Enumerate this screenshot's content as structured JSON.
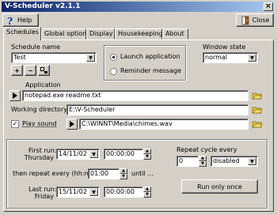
{
  "window": {
    "title": "V-Scheduler v2.1.1",
    "close_glyph": "×"
  },
  "toolbar": {
    "help_label": "Help",
    "close_label": "Close"
  },
  "tabs": [
    {
      "label": "Schedules"
    },
    {
      "label": "Global options"
    },
    {
      "label": "Display"
    },
    {
      "label": "Housekeeping"
    },
    {
      "label": "About"
    }
  ],
  "schedule": {
    "name_label": "Schedule name",
    "name_value": "Test",
    "add_glyph": "+",
    "remove_glyph": "−",
    "launch_label": "Launch application",
    "reminder_label": "Reminder message",
    "window_state_label": "Window state",
    "window_state_value": "normal"
  },
  "application": {
    "label": "Application",
    "value": "notepad.exe readme.txt",
    "working_dir_label": "Working directory",
    "working_dir_value": "E:\\V-Scheduler",
    "play_sound_label": "Play sound",
    "sound_value": "C:\\WINNT\\Media\\chimes.wav"
  },
  "timing": {
    "first_run_label": "First run:",
    "first_run_day": "Thursday",
    "first_run_date": "14/11/02",
    "first_run_time": "00:00:00",
    "repeat_label": "then repeat every (hh:mm)",
    "repeat_value": "01:00",
    "until_label": "until ...",
    "last_run_label": "Last run:",
    "last_run_day": "Friday",
    "last_run_date": "15/11/02",
    "last_run_time": "00:00:00",
    "repeat_cycle_label": "Repeat cycle every",
    "repeat_cycle_value": "0",
    "repeat_cycle_unit": "disabled",
    "run_once_label": "Run only once"
  },
  "colors": {
    "title_start": "#0a246a",
    "title_end": "#a6caf0",
    "face": "#d4d0c8"
  },
  "icons": {
    "help": "help-question-icon",
    "close": "close-door-icon",
    "folder": "folder-open-icon",
    "play": "play-icon",
    "test": "test-run-icon"
  }
}
